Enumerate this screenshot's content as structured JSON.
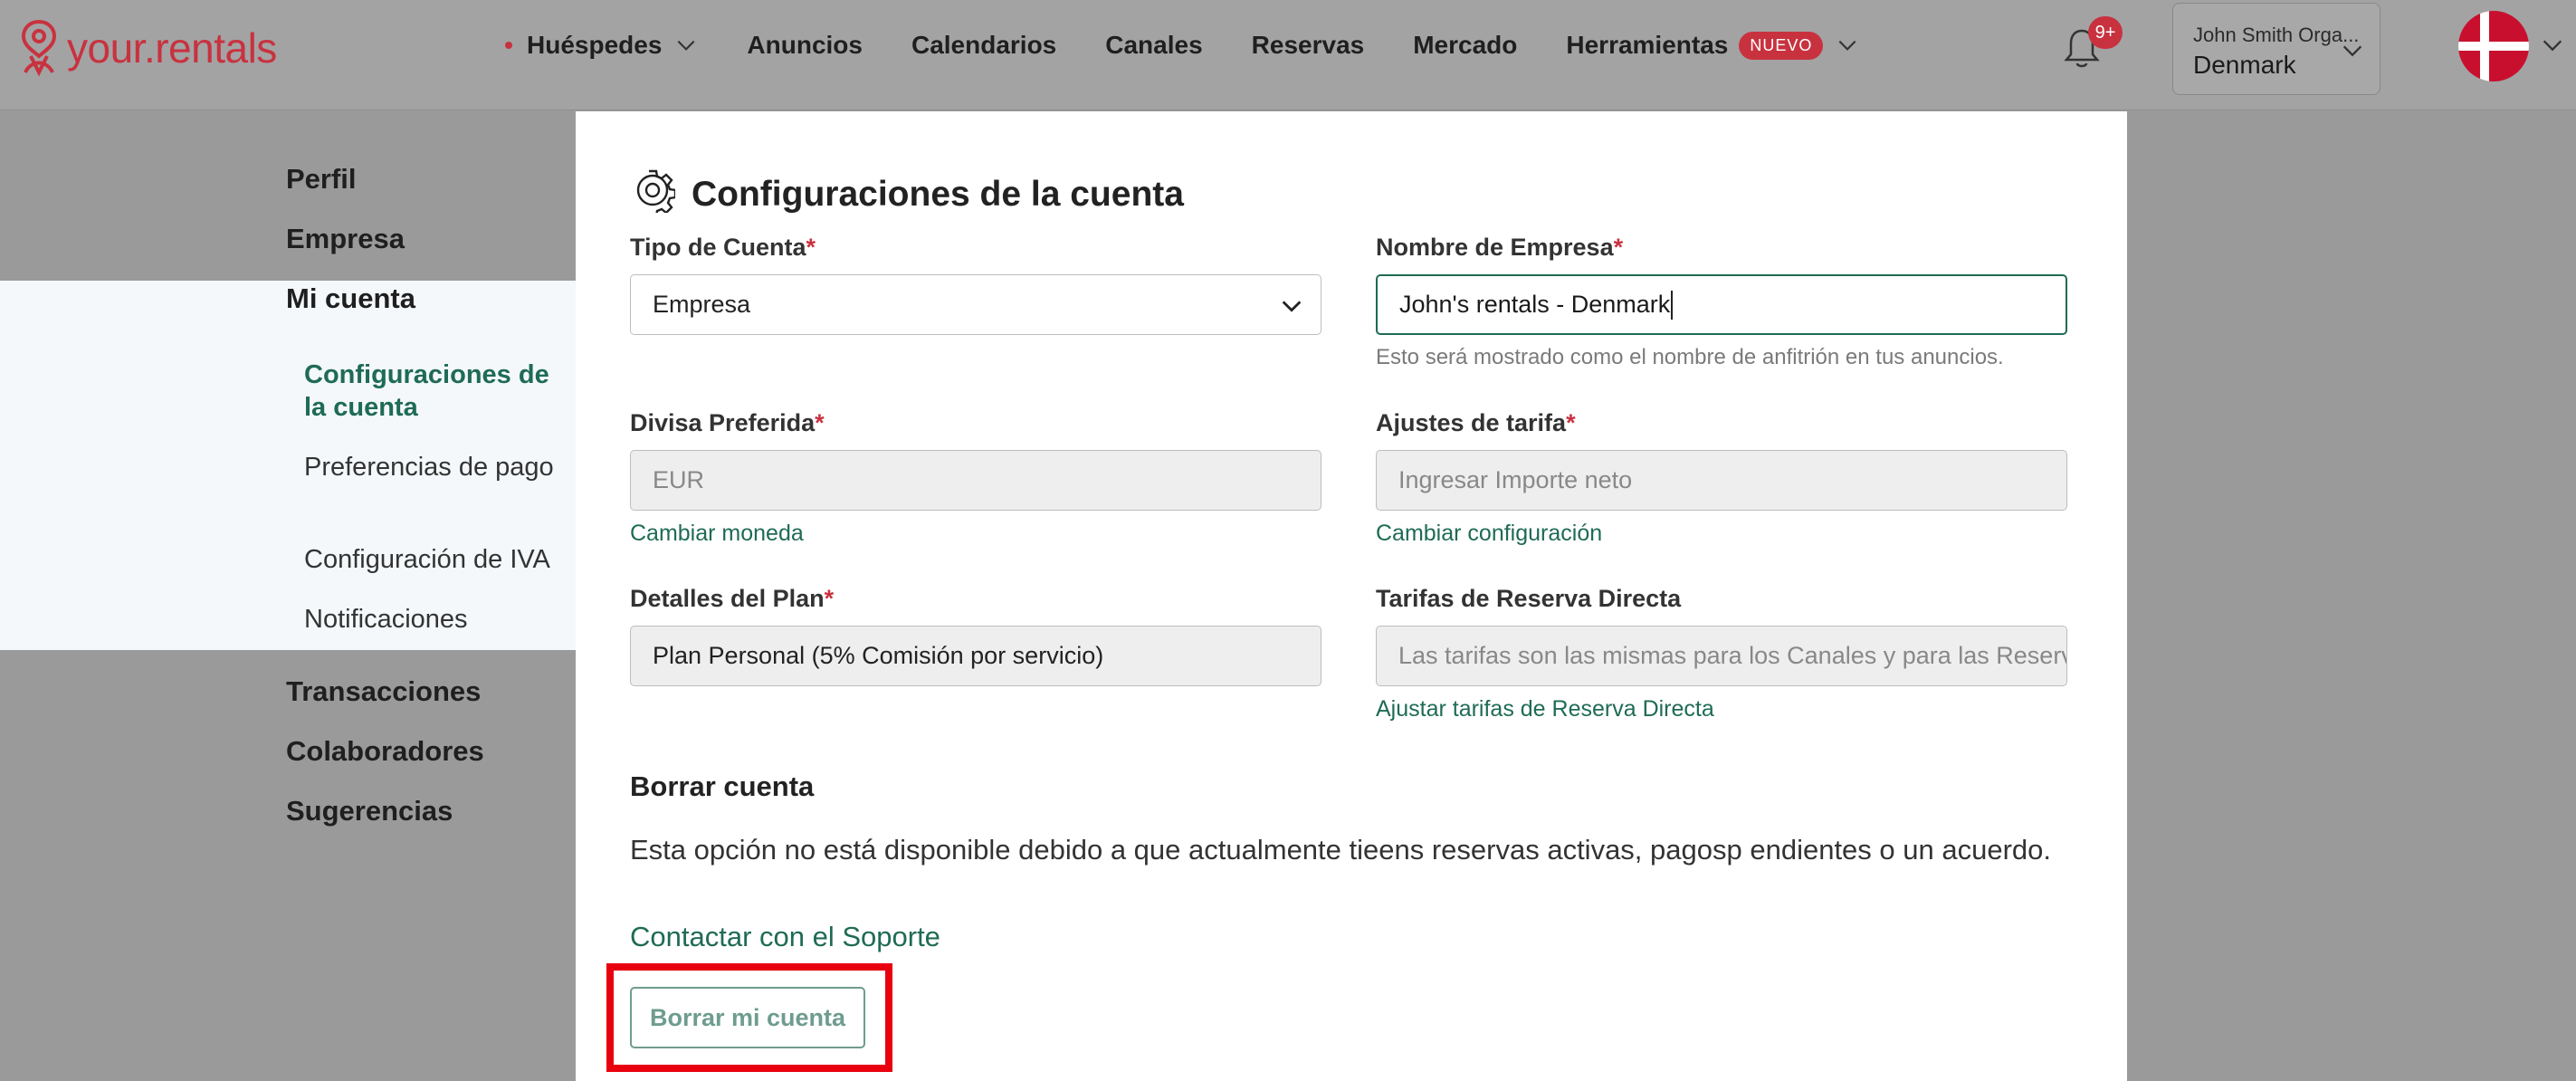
{
  "brand": {
    "logo_text": "your.rentals",
    "accent_color": "#c8323f",
    "primary_color": "#1f6b55"
  },
  "nav": {
    "items": [
      {
        "label": "Huéspedes",
        "has_dot": true,
        "has_dropdown": true
      },
      {
        "label": "Anuncios"
      },
      {
        "label": "Calendarios"
      },
      {
        "label": "Canales"
      },
      {
        "label": "Reservas"
      },
      {
        "label": "Mercado"
      },
      {
        "label": "Herramientas",
        "badge": "NUEVO",
        "has_dropdown": true
      }
    ],
    "notifications_badge": "9+",
    "org": {
      "name": "John Smith Orga...",
      "country": "Denmark"
    },
    "avatar_icon": "denmark-flag-icon"
  },
  "sidebar": {
    "items": [
      "Perfil",
      "Empresa",
      "Mi cuenta",
      "Transacciones",
      "Colaboradores",
      "Sugerencias"
    ],
    "subitems": [
      "Configuraciones de la cuenta",
      "Preferencias de pago",
      "Configuración de IVA",
      "Notificaciones"
    ],
    "active_subitem": "Configuraciones de la cuenta"
  },
  "page": {
    "title": "Configuraciones de la cuenta",
    "title_icon": "gear-icon",
    "required_mark": "*",
    "fields": {
      "account_type": {
        "label": "Tipo de Cuenta",
        "value": "Empresa"
      },
      "company_name": {
        "label": "Nombre de Empresa",
        "value": "John's rentals - Denmark",
        "help": "Esto será mostrado como el nombre de anfitrión en tus anuncios."
      },
      "currency": {
        "label": "Divisa Preferida",
        "value": "EUR",
        "link": "Cambiar moneda"
      },
      "rate_settings": {
        "label": "Ajustes de tarifa",
        "placeholder": "Ingresar Importe neto",
        "link": "Cambiar configuración"
      },
      "plan": {
        "label": "Detalles del Plan",
        "value": "Plan Personal (5% Comisión por servicio)"
      },
      "direct_rates": {
        "label": "Tarifas de Reserva Directa",
        "value": "Las tarifas son las mismas para los Canales y para las Reservas Directas",
        "link": "Ajustar tarifas de Reserva Directa"
      }
    },
    "delete": {
      "title": "Borrar cuenta",
      "description": "Esta opción no está disponible debido a que actualmente tieens reservas activas, pagosp endientes o un acuerdo.",
      "support_link": "Contactar con el Soporte",
      "button": "Borrar mi cuenta"
    }
  }
}
